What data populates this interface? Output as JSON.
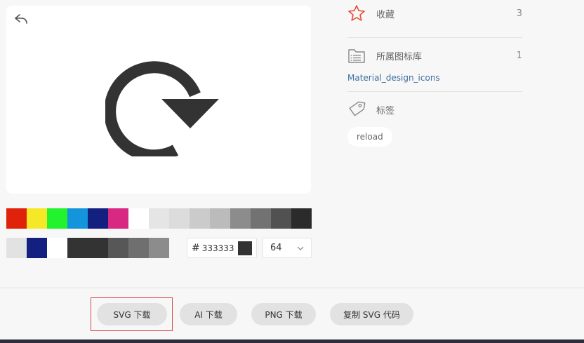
{
  "preview": {
    "back_icon": "undo-arrow-icon",
    "main_icon": "reload-icon",
    "icon_color": "#333333"
  },
  "palette": {
    "row1": [
      "#e0220b",
      "#f5e826",
      "#23f22f",
      "#1394db",
      "#13207f",
      "#d92882",
      "#ffffff",
      "#e5e5e5",
      "#dcdcdc",
      "#cbcbcb",
      "#bbbbbb",
      "#8c8c8c",
      "#727272",
      "#515151",
      "#2b2b2b"
    ],
    "row2": [
      "#e2e2e2",
      "#13207f",
      "#ffffff",
      "#333333",
      "#333333",
      "#575757",
      "#6f6f6f",
      "#8c8c8c"
    ]
  },
  "color_input": {
    "hash": "#",
    "value": "333333"
  },
  "size_select": {
    "value": "64"
  },
  "sidebar": {
    "favorites": {
      "label": "收藏",
      "count": "3"
    },
    "library": {
      "label": "所属图标库",
      "count": "1",
      "link": "Material_design_icons"
    },
    "tags": {
      "label": "标签",
      "items": [
        "reload"
      ]
    }
  },
  "footer": {
    "svg_download": "SVG 下载",
    "ai_download": "AI 下载",
    "png_download": "PNG 下载",
    "copy_svg": "复制 SVG 代码"
  }
}
